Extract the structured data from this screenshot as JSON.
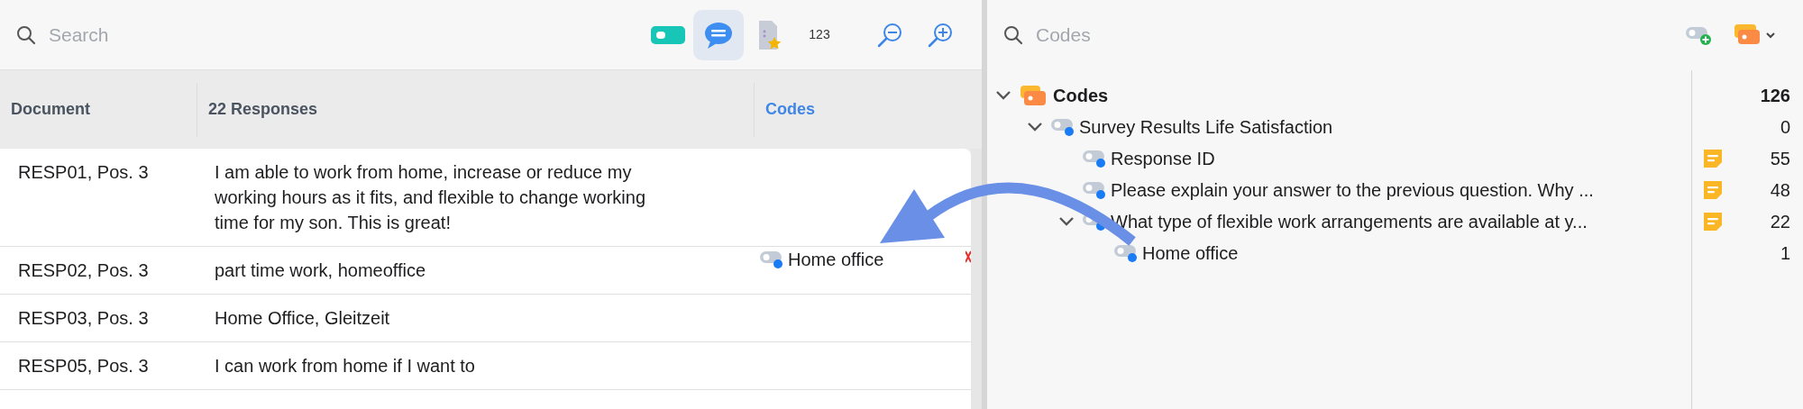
{
  "left_panel": {
    "search": {
      "placeholder": "Search"
    },
    "toolbar": [
      {
        "kind": "code",
        "selected": false
      },
      {
        "kind": "comment",
        "selected": true
      },
      {
        "kind": "document",
        "selected": false
      },
      {
        "kind": "numbers",
        "label": "123",
        "selected": false
      },
      {
        "kind": "zoom-out",
        "selected": false
      },
      {
        "kind": "zoom-in",
        "selected": false
      }
    ],
    "table": {
      "columns": [
        {
          "label": "Document",
          "active": false
        },
        {
          "label": "22 Responses",
          "active": false
        },
        {
          "label": "Codes",
          "active": true
        }
      ],
      "rows": [
        {
          "document": "RESP01, Pos. 3",
          "response": "I am able to work from home, increase or reduce my working hours as it fits, and flexible to change working time for my son. This is great!",
          "codes": []
        },
        {
          "document": "RESP02, Pos. 3",
          "response": "part time work, homeoffice",
          "codes": [
            {
              "name": "Home office",
              "removable": true
            }
          ]
        },
        {
          "document": "RESP03, Pos. 3",
          "response": "Home Office, Gleitzeit",
          "codes": []
        },
        {
          "document": "RESP05, Pos. 3",
          "response": "I can work from home if I want to",
          "codes": []
        }
      ]
    }
  },
  "right_panel": {
    "search": {
      "placeholder": "Codes"
    },
    "tree": [
      {
        "kind": "root",
        "name": "Codes",
        "count": "126",
        "memo": false,
        "expanded": true,
        "children": [
          {
            "kind": "code",
            "name": "Survey Results Life Satisfaction",
            "count": "0",
            "memo": false,
            "expanded": true,
            "children": [
              {
                "kind": "code",
                "name": "Response ID",
                "count": "55",
                "memo": true
              },
              {
                "kind": "code",
                "name": "Please explain your answer to the previous question. Why ...",
                "count": "48",
                "memo": true
              },
              {
                "kind": "code",
                "name": "What type of flexible work arrangements are available at y...",
                "count": "22",
                "memo": true,
                "expanded": true,
                "children": [
                  {
                    "kind": "code",
                    "name": "Home office",
                    "count": "1",
                    "memo": false
                  }
                ]
              }
            ]
          }
        ]
      }
    ]
  }
}
